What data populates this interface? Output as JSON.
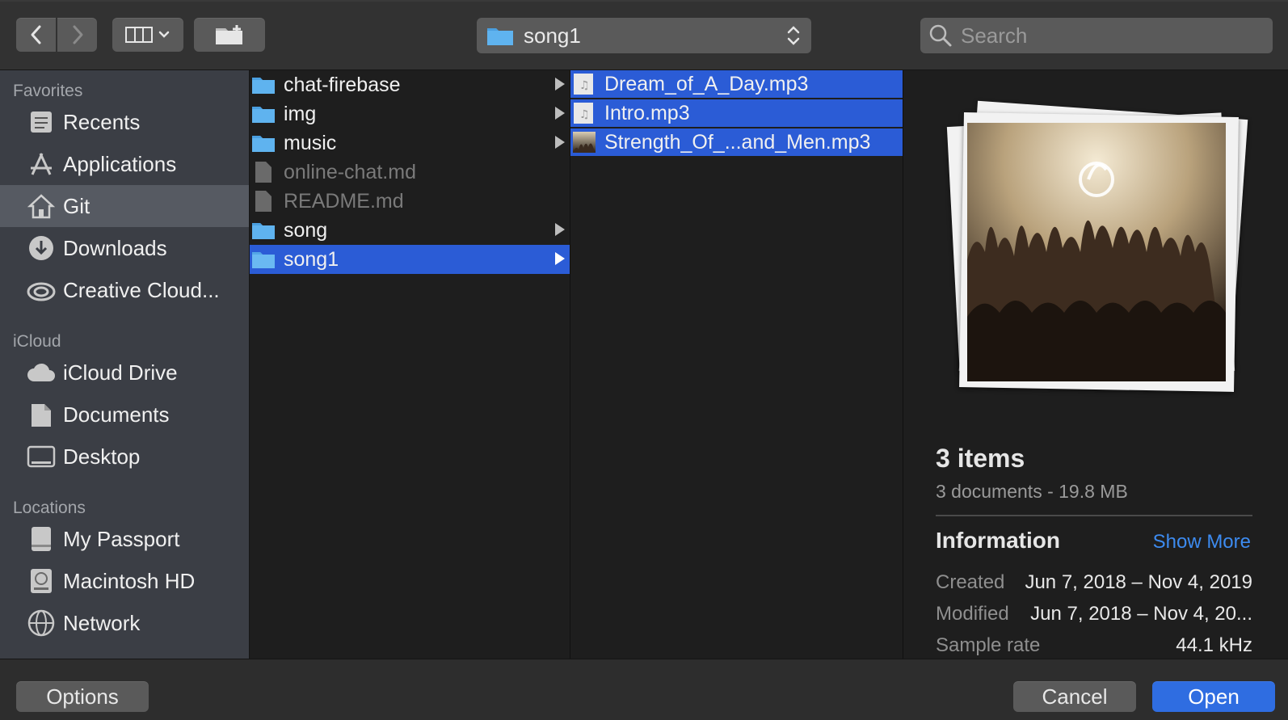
{
  "toolbar": {
    "back_icon": "chevron-left-icon",
    "forward_icon": "chevron-right-icon",
    "view_icon": "column-view-icon",
    "new_folder_icon": "new-folder-icon",
    "path_label": "song1",
    "search_placeholder": "Search"
  },
  "sidebar": {
    "sections": [
      {
        "header": "Favorites",
        "items": [
          {
            "label": "Recents",
            "icon": "recents-icon"
          },
          {
            "label": "Applications",
            "icon": "applications-icon"
          },
          {
            "label": "Git",
            "icon": "home-icon",
            "active": true
          },
          {
            "label": "Downloads",
            "icon": "downloads-icon"
          },
          {
            "label": "Creative Cloud...",
            "icon": "creative-cloud-icon"
          }
        ]
      },
      {
        "header": "iCloud",
        "items": [
          {
            "label": "iCloud Drive",
            "icon": "cloud-icon"
          },
          {
            "label": "Documents",
            "icon": "documents-icon"
          },
          {
            "label": "Desktop",
            "icon": "desktop-icon"
          }
        ]
      },
      {
        "header": "Locations",
        "items": [
          {
            "label": "My Passport",
            "icon": "external-drive-icon"
          },
          {
            "label": "Macintosh HD",
            "icon": "hard-drive-icon"
          },
          {
            "label": "Network",
            "icon": "network-icon"
          }
        ]
      }
    ]
  },
  "column1": {
    "items": [
      {
        "name": "chat-firebase",
        "kind": "folder"
      },
      {
        "name": "img",
        "kind": "folder"
      },
      {
        "name": "music",
        "kind": "folder"
      },
      {
        "name": "online-chat.md",
        "kind": "file"
      },
      {
        "name": "README.md",
        "kind": "file"
      },
      {
        "name": "song",
        "kind": "folder"
      },
      {
        "name": "song1",
        "kind": "folder",
        "selected": true
      }
    ]
  },
  "column2": {
    "items": [
      {
        "name": "Dream_of_A_Day.mp3",
        "kind": "audio"
      },
      {
        "name": "Intro.mp3",
        "kind": "audio"
      },
      {
        "name": "Strength_Of_...and_Men.mp3",
        "kind": "audio-art"
      }
    ]
  },
  "preview": {
    "count_title": "3 items",
    "count_sub": "3 documents - 19.8 MB",
    "info_title": "Information",
    "show_more": "Show More",
    "rows": [
      {
        "key": "Created",
        "value": "Jun 7, 2018 – Nov 4, 2019"
      },
      {
        "key": "Modified",
        "value": "Jun 7, 2018 – Nov 4, 20..."
      },
      {
        "key": "Sample rate",
        "value": "44.1 kHz"
      }
    ]
  },
  "bottombar": {
    "options_label": "Options",
    "cancel_label": "Cancel",
    "open_label": "Open"
  },
  "colors": {
    "selection": "#2b5cd6",
    "accent_link": "#3d8bf0",
    "primary_button": "#2f6de1"
  }
}
